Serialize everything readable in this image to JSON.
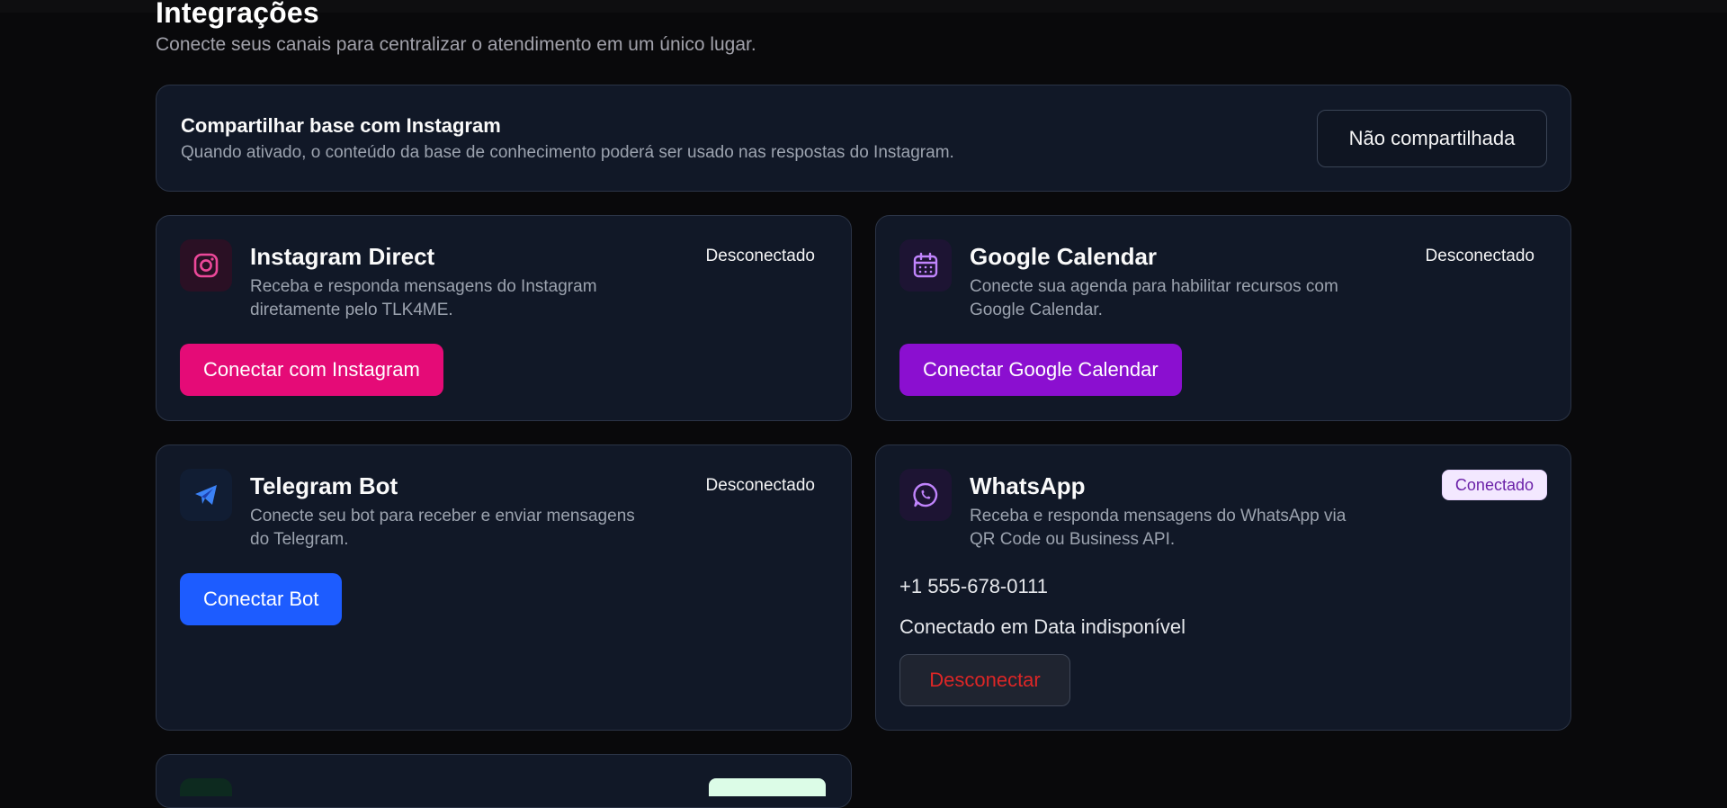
{
  "page": {
    "title": "Integrações",
    "subtitle": "Conecte seus canais para centralizar o atendimento em um único lugar."
  },
  "share": {
    "title": "Compartilhar base com Instagram",
    "description": "Quando ativado, o conteúdo da base de conhecimento poderá ser usado nas respostas do Instagram.",
    "button_label": "Não compartilhada"
  },
  "integrations": [
    {
      "name": "Instagram Direct",
      "description": "Receba e responda mensagens do Instagram diretamente pelo TLK4ME.",
      "status": "Desconectado",
      "action_label": "Conectar com Instagram",
      "icon": "instagram-icon",
      "color": "#e50b77"
    },
    {
      "name": "Google Calendar",
      "description": "Conecte sua agenda para habilitar recursos com Google Calendar.",
      "status": "Desconectado",
      "action_label": "Conectar Google Calendar",
      "icon": "calendar-icon",
      "color": "#8b0fd0"
    },
    {
      "name": "Telegram Bot",
      "description": "Conecte seu bot para receber e enviar mensagens do Telegram.",
      "status": "Desconectado",
      "action_label": "Conectar Bot",
      "icon": "telegram-icon",
      "color": "#1d5cff"
    },
    {
      "name": "WhatsApp",
      "description": "Receba e responda mensagens do WhatsApp via QR Code ou Business API.",
      "status": "Conectado",
      "phone": "+1 555-678-0111",
      "connected_info": "Conectado em Data indisponível",
      "disconnect_label": "Desconectar",
      "icon": "whatsapp-icon",
      "color": "#a855f7"
    }
  ]
}
